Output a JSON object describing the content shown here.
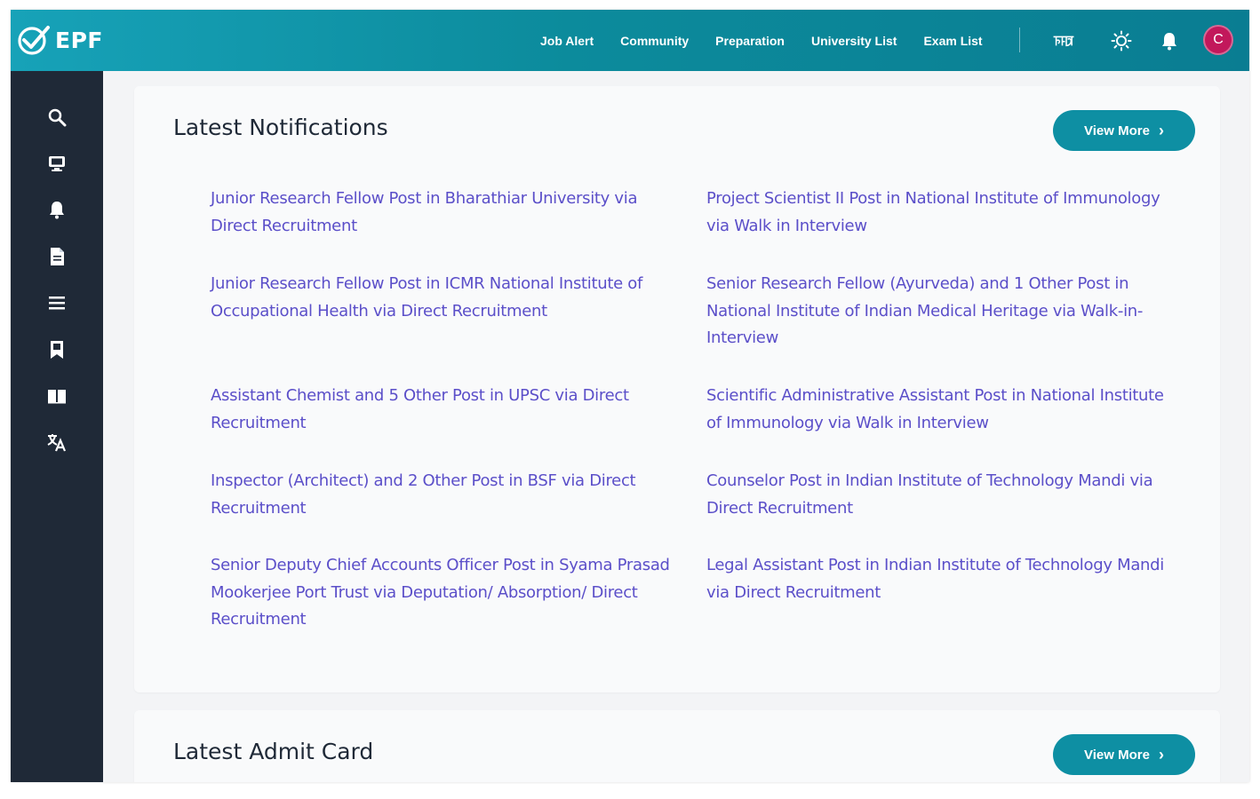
{
  "brand": {
    "name": "EPF"
  },
  "nav": {
    "items": [
      "Job Alert",
      "Community",
      "Preparation",
      "University List",
      "Exam List"
    ]
  },
  "topbar_icons": [
    "language-icon",
    "theme-toggle-icon",
    "notification-bell-icon"
  ],
  "user": {
    "avatar_initial": "C",
    "avatar_color": "#c2185b"
  },
  "sidebar": {
    "icons": [
      "search-icon",
      "monitor-icon",
      "bell-icon",
      "document-icon",
      "list-icon",
      "bookmark-icon",
      "book-icon",
      "translate-icon"
    ]
  },
  "notifications": {
    "title": "Latest Notifications",
    "view_more": "View More",
    "items": [
      "Junior Research Fellow Post in Bharathiar University via Direct Recruitment",
      "Project Scientist II Post in National Institute of Immunology via Walk in Interview",
      "Junior Research Fellow Post in ICMR National Institute of Occupational Health via Direct Recruitment",
      "Senior Research Fellow (Ayurveda) and 1 Other Post in National Institute of Indian Medical Heritage via Walk-in-Interview",
      "Assistant Chemist and 5 Other Post in UPSC via Direct Recruitment",
      "Scientific Administrative Assistant Post in National Institute of Immunology via Walk in Interview",
      "Inspector (Architect) and 2 Other Post in BSF via Direct Recruitment",
      "Counselor Post in Indian Institute of Technology Mandi via Direct Recruitment",
      "Senior Deputy Chief Accounts Officer Post in Syama Prasad Mookerjee Port Trust via Deputation/ Absorption/ Direct Recruitment",
      "Legal Assistant Post in Indian Institute of Technology Mandi via Direct Recruitment"
    ]
  },
  "admit_card": {
    "title": "Latest Admit Card",
    "view_more": "View More"
  },
  "colors": {
    "header_start": "#17a2b8",
    "header_end": "#0a7d92",
    "sidebar": "#1f2937",
    "link": "#5b4fc9",
    "button": "#0e8fa3"
  }
}
